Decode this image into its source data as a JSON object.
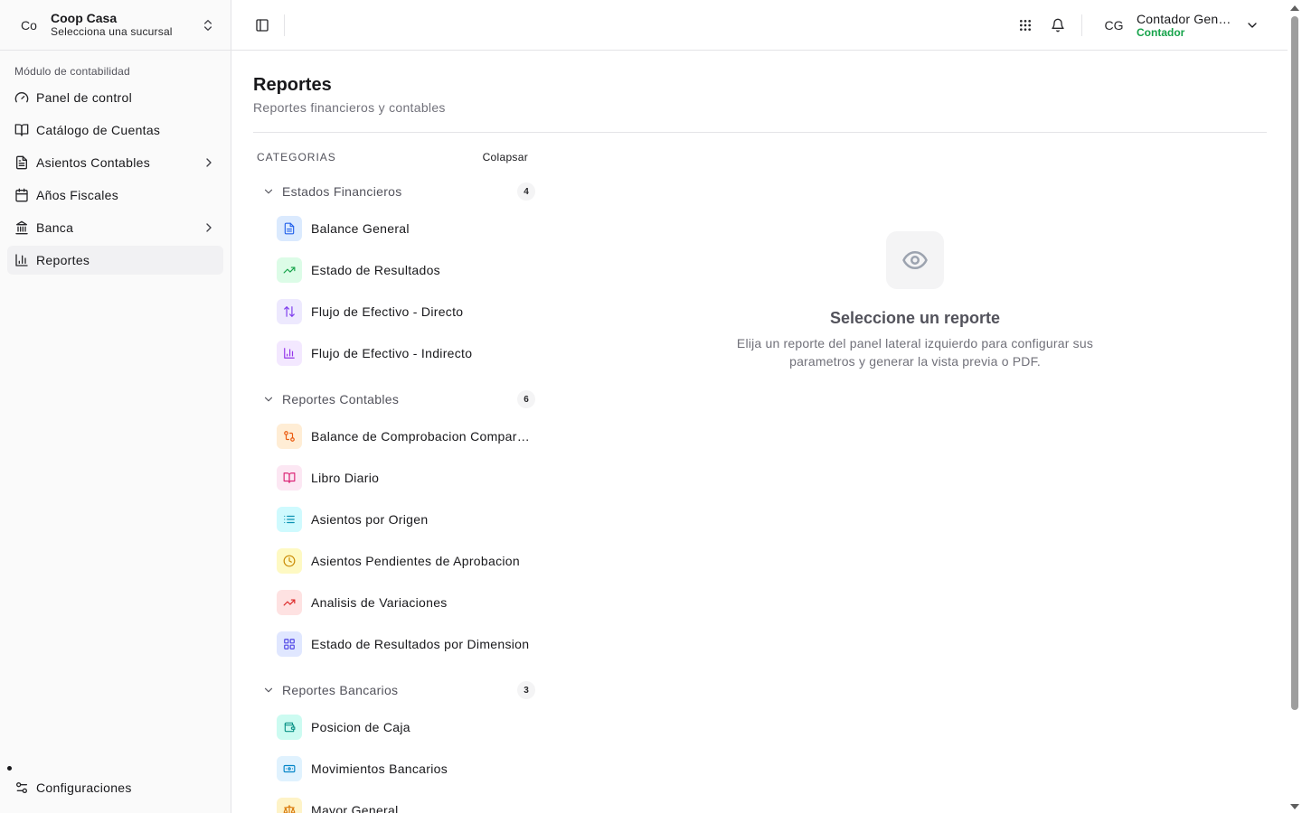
{
  "org": {
    "initials": "Co",
    "name": "Coop Casa",
    "branch": "Selecciona una sucursal"
  },
  "sidebar": {
    "section_label": "Módulo de contabilidad",
    "items": [
      {
        "label": "Panel de control",
        "icon": "gauge-icon"
      },
      {
        "label": "Catálogo de Cuentas",
        "icon": "book-open-icon"
      },
      {
        "label": "Asientos Contables",
        "icon": "file-text-icon",
        "has_children": true
      },
      {
        "label": "Años Fiscales",
        "icon": "calendar-icon"
      },
      {
        "label": "Banca",
        "icon": "landmark-icon",
        "has_children": true
      },
      {
        "label": "Reportes",
        "icon": "bar-chart-icon",
        "active": true
      }
    ],
    "settings_label": "Configuraciones"
  },
  "user": {
    "initials": "CG",
    "name": "Contador General",
    "role": "Contador",
    "role_color": "#16a34a"
  },
  "page": {
    "title": "Reportes",
    "subtitle": "Reportes financieros y contables"
  },
  "categories": {
    "title": "CATEGORIAS",
    "collapse_label": "Colapsar",
    "groups": [
      {
        "name": "Estados Financieros",
        "count": "4",
        "items": [
          {
            "label": "Balance General",
            "icon": "file-text-icon",
            "bg": "#dbeafe",
            "fg": "#2563eb"
          },
          {
            "label": "Estado de Resultados",
            "icon": "trending-up-icon",
            "bg": "#dcfce7",
            "fg": "#16a34a"
          },
          {
            "label": "Flujo de Efectivo - Directo",
            "icon": "arrow-up-down-icon",
            "bg": "#ede9fe",
            "fg": "#7c3aed"
          },
          {
            "label": "Flujo de Efectivo - Indirecto",
            "icon": "bar-chart-icon",
            "bg": "#f3e8ff",
            "fg": "#9333ea"
          }
        ]
      },
      {
        "name": "Reportes Contables",
        "count": "6",
        "items": [
          {
            "label": "Balance de Comprobacion Comparativo",
            "icon": "git-compare-icon",
            "bg": "#ffedd5",
            "fg": "#ea580c"
          },
          {
            "label": "Libro Diario",
            "icon": "book-open-icon",
            "bg": "#fce7f3",
            "fg": "#db2777"
          },
          {
            "label": "Asientos por Origen",
            "icon": "list-icon",
            "bg": "#cffafe",
            "fg": "#0891b2"
          },
          {
            "label": "Asientos Pendientes de Aprobacion",
            "icon": "clock-icon",
            "bg": "#fef9c3",
            "fg": "#ca8a04"
          },
          {
            "label": "Analisis de Variaciones",
            "icon": "trending-up-icon",
            "bg": "#fee2e2",
            "fg": "#dc2626"
          },
          {
            "label": "Estado de Resultados por Dimension",
            "icon": "grid-icon",
            "bg": "#e0e7ff",
            "fg": "#4f46e5"
          }
        ]
      },
      {
        "name": "Reportes Bancarios",
        "count": "3",
        "items": [
          {
            "label": "Posicion de Caja",
            "icon": "wallet-icon",
            "bg": "#ccfbf1",
            "fg": "#0d9488"
          },
          {
            "label": "Movimientos Bancarios",
            "icon": "banknote-icon",
            "bg": "#e0f2fe",
            "fg": "#0284c7"
          },
          {
            "label": "Mayor General",
            "icon": "scale-icon",
            "bg": "#fef3c7",
            "fg": "#d97706"
          }
        ]
      }
    ]
  },
  "empty_state": {
    "icon": "eye-icon",
    "title": "Seleccione un reporte",
    "text": "Elija un reporte del panel lateral izquierdo para configurar sus parametros y generar la vista previa o PDF."
  }
}
